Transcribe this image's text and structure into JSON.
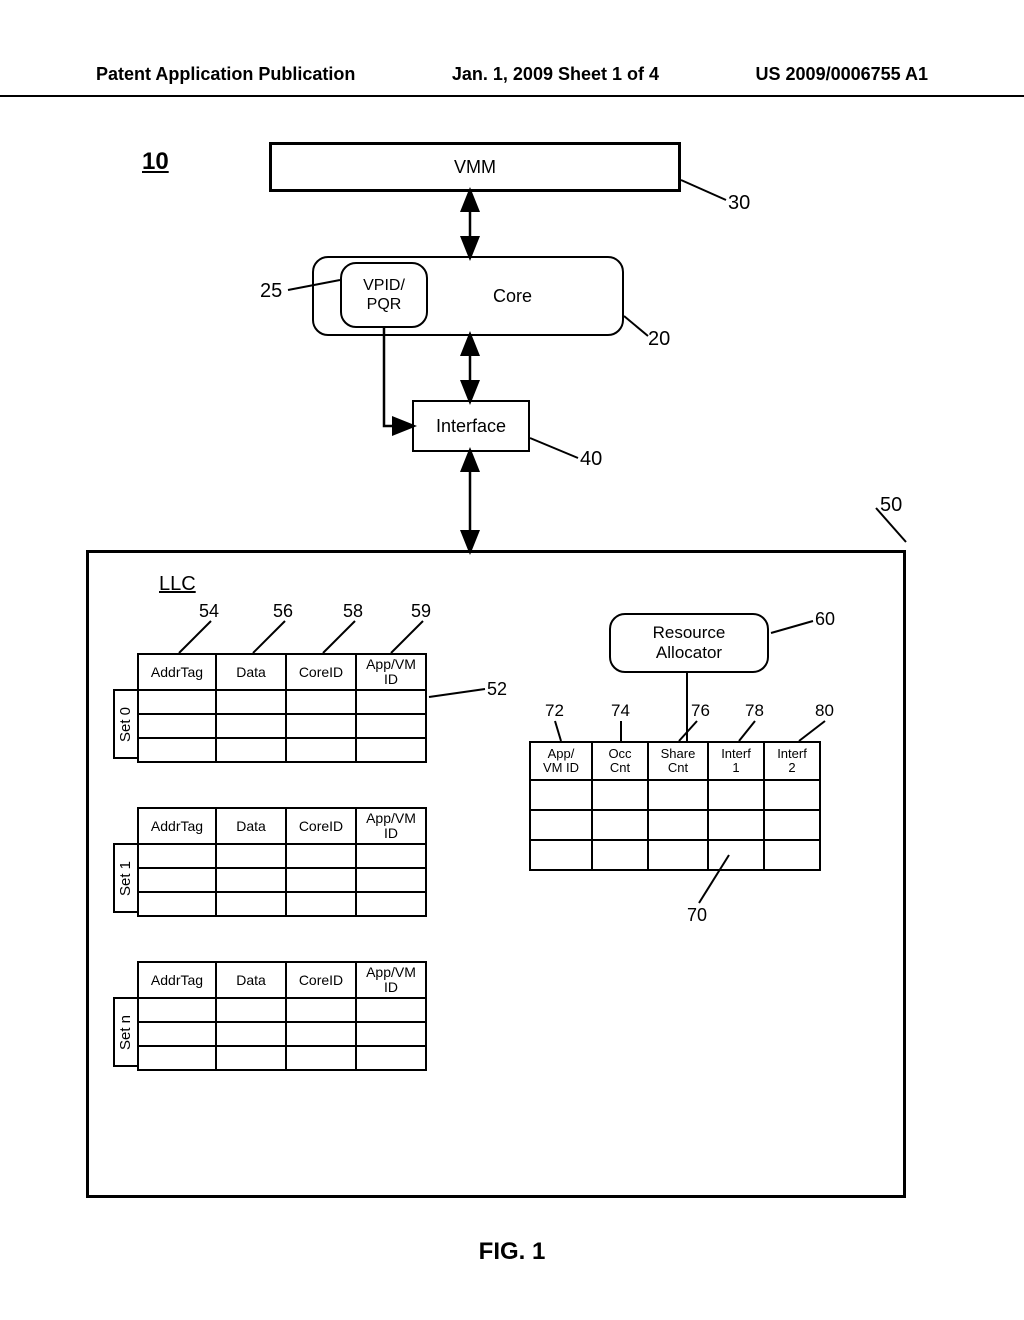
{
  "header": {
    "left": "Patent Application Publication",
    "center": "Jan. 1, 2009  Sheet 1 of 4",
    "right": "US 2009/0006755 A1"
  },
  "figure_label": "FIG. 1",
  "refs": {
    "r10": "10",
    "r20": "20",
    "r25": "25",
    "r30": "30",
    "r40": "40",
    "r50": "50",
    "r52": "52",
    "r54": "54",
    "r56": "56",
    "r58": "58",
    "r59": "59",
    "r60": "60",
    "r70": "70",
    "r72": "72",
    "r74": "74",
    "r76": "76",
    "r78": "78",
    "r80": "80"
  },
  "blocks": {
    "vmm": "VMM",
    "vpid": "VPID/\nPQR",
    "core": "Core",
    "interface": "Interface",
    "llc": "LLC",
    "resource_allocator": "Resource\nAllocator"
  },
  "cache_table": {
    "cols": [
      "AddrTag",
      "Data",
      "CoreID",
      "App/VM\nID"
    ],
    "sets": [
      "Set 0",
      "Set 1",
      "Set n"
    ]
  },
  "alloc_table": {
    "cols": [
      "App/\nVM ID",
      "Occ\nCnt",
      "Share\nCnt",
      "Interf\n1",
      "Interf\n2"
    ]
  }
}
